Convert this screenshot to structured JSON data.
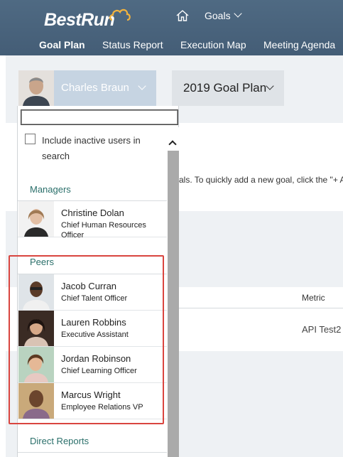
{
  "app": {
    "logo_text": "BestRun"
  },
  "topnav": {
    "menu_label": "Goals"
  },
  "tabs": [
    {
      "label": "Goal Plan",
      "active": true
    },
    {
      "label": "Status Report",
      "active": false
    },
    {
      "label": "Execution Map",
      "active": false
    },
    {
      "label": "Meeting Agenda",
      "active": false
    }
  ],
  "selected_user": {
    "name": "Charles Braun"
  },
  "goal_plan": {
    "selected": "2019 Goal Plan"
  },
  "page_text": {
    "instruction": "als. To quickly add a new goal, click the \"+ A",
    "metric_header": "Metric",
    "metric_value": "API Test2"
  },
  "dropdown": {
    "search_value": "",
    "include_inactive_label": "Include inactive users in search",
    "include_inactive_checked": false,
    "sections": {
      "managers": {
        "title": "Managers",
        "people": [
          {
            "name": "Christine Dolan",
            "title": "Chief Human Resources Officer"
          }
        ]
      },
      "peers": {
        "title": "Peers",
        "people": [
          {
            "name": "Jacob Curran",
            "title": "Chief Talent Officer"
          },
          {
            "name": "Lauren Robbins",
            "title": "Executive Assistant"
          },
          {
            "name": "Jordan Robinson",
            "title": "Chief Learning Officer"
          },
          {
            "name": "Marcus Wright",
            "title": "Employee Relations VP"
          }
        ]
      },
      "direct_reports": {
        "title": "Direct Reports"
      }
    }
  },
  "colors": {
    "header_bg": "#4a647d",
    "accent_teal": "#2a6f6a",
    "highlight": "#d9453f"
  }
}
